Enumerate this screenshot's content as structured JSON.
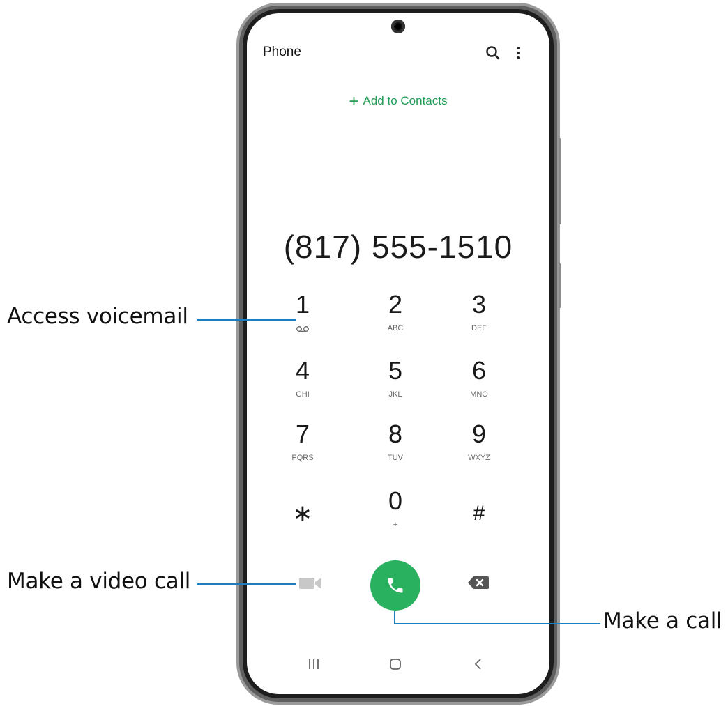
{
  "app": {
    "title": "Phone",
    "add_contacts_label": "Add to Contacts",
    "dialed_number": "(817) 555-1510"
  },
  "keypad": [
    {
      "digit": "1",
      "letters": "",
      "icon": "voicemail-icon"
    },
    {
      "digit": "2",
      "letters": "ABC"
    },
    {
      "digit": "3",
      "letters": "DEF"
    },
    {
      "digit": "4",
      "letters": "GHI"
    },
    {
      "digit": "5",
      "letters": "JKL"
    },
    {
      "digit": "6",
      "letters": "MNO"
    },
    {
      "digit": "7",
      "letters": "PQRS"
    },
    {
      "digit": "8",
      "letters": "TUV"
    },
    {
      "digit": "9",
      "letters": "WXYZ"
    },
    {
      "digit": "∗",
      "letters": ""
    },
    {
      "digit": "0",
      "letters": "+"
    },
    {
      "digit": "#",
      "letters": ""
    }
  ],
  "icons": {
    "header": [
      "search-icon",
      "more-options-icon"
    ],
    "actions": [
      "video-call-icon",
      "phone-icon",
      "backspace-icon"
    ],
    "nav": [
      "recents-icon",
      "home-icon",
      "back-icon"
    ]
  },
  "colors": {
    "accent_green": "#29b15f",
    "add_contacts_green": "#1f9a52",
    "callout_line": "#1b7fbf"
  },
  "callouts": {
    "voicemail": "Access voicemail",
    "video_call": "Make a video call",
    "call": "Make a call"
  }
}
